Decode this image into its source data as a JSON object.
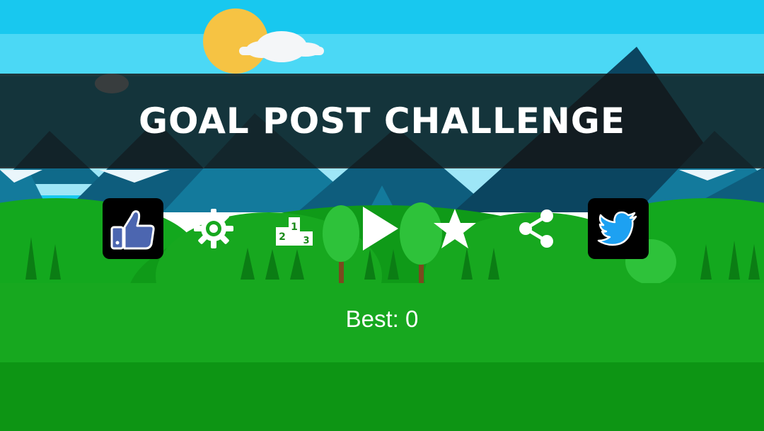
{
  "game": {
    "title": "GOAL POST CHALLENGE",
    "best_label": "Best: 0",
    "best_score": 0
  },
  "menu": {
    "buttons": [
      {
        "id": "like",
        "icon": "thumbs-up-icon"
      },
      {
        "id": "settings",
        "icon": "gear-icon"
      },
      {
        "id": "leaderboard",
        "icon": "podium-icon"
      },
      {
        "id": "play",
        "icon": "play-icon"
      },
      {
        "id": "rate",
        "icon": "star-icon"
      },
      {
        "id": "share",
        "icon": "share-icon"
      },
      {
        "id": "twitter",
        "icon": "twitter-bird-icon"
      }
    ]
  },
  "podium": {
    "first": "1",
    "second": "2",
    "third": "3"
  },
  "colors": {
    "sky": "#38d3f3",
    "sun": "#f6c343",
    "mountain_dark": "#0e4f6b",
    "mountain_mid": "#137a9c",
    "grass_light": "#17a81f",
    "grass_dark": "#0e8a14",
    "facebook_blue": "#4c66b0",
    "twitter_blue": "#1da1f2",
    "podium_green": "#1a8a1a"
  }
}
